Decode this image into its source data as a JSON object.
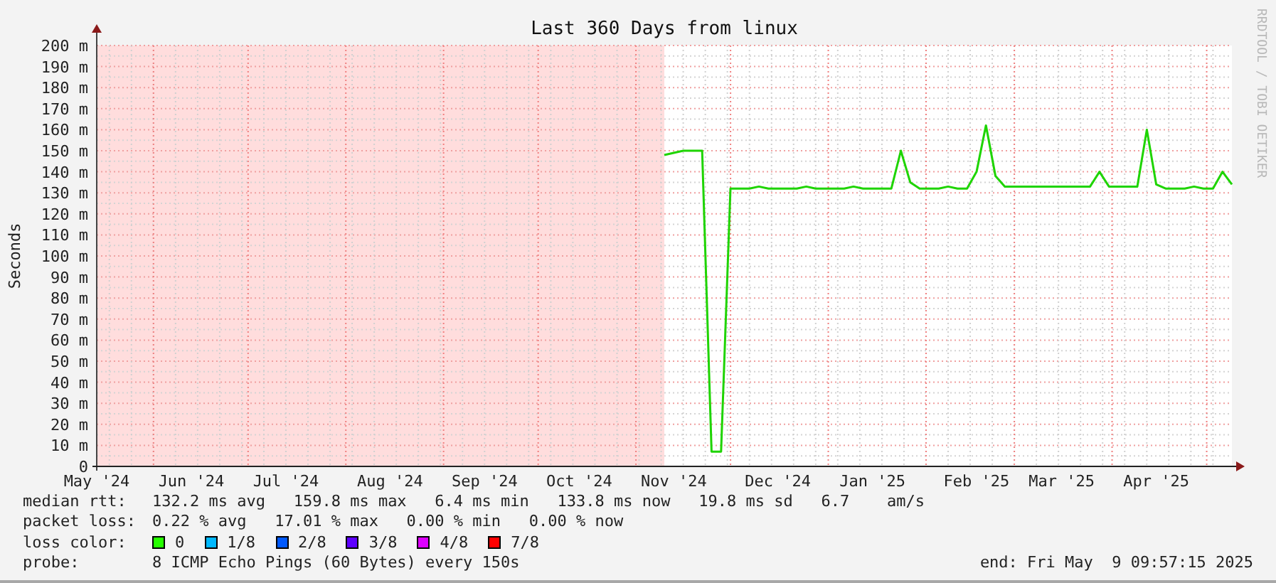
{
  "graph": {
    "title": "Last 360 Days from linux",
    "credit": "RRDTOOL / TOBI OETIKER",
    "chart_data": {
      "type": "line",
      "grid": true,
      "ylabel": "Seconds",
      "ylim": [
        0,
        200
      ],
      "categories": [
        "May '24",
        null,
        null,
        null,
        null,
        null,
        null,
        null,
        null,
        null,
        "Jun '24",
        null,
        null,
        null,
        null,
        null,
        null,
        null,
        null,
        null,
        "Jul '24",
        null,
        null,
        null,
        null,
        null,
        null,
        null,
        null,
        null,
        null,
        "Aug '24",
        null,
        null,
        null,
        null,
        null,
        null,
        null,
        null,
        null,
        "Sep '24",
        null,
        null,
        null,
        null,
        null,
        null,
        null,
        null,
        null,
        "Oct '24",
        null,
        null,
        null,
        null,
        null,
        null,
        null,
        null,
        null,
        "Nov '24",
        null,
        null,
        null,
        null,
        null,
        null,
        null,
        null,
        null,
        null,
        "Dec '24",
        null,
        null,
        null,
        null,
        null,
        null,
        null,
        null,
        null,
        "Jan '25",
        null,
        null,
        null,
        null,
        null,
        null,
        null,
        null,
        null,
        null,
        "Feb '25",
        null,
        null,
        null,
        null,
        null,
        null,
        null,
        null,
        "Mar '25",
        null,
        null,
        null,
        null,
        null,
        null,
        null,
        null,
        null,
        "Apr '25",
        null,
        null,
        null,
        null,
        null,
        null,
        null,
        null
      ],
      "series": [
        {
          "color": "#1ed400",
          "values": [
            null,
            null,
            null,
            null,
            null,
            null,
            null,
            null,
            null,
            null,
            null,
            null,
            null,
            null,
            null,
            null,
            null,
            null,
            null,
            null,
            null,
            null,
            null,
            null,
            null,
            null,
            null,
            null,
            null,
            null,
            null,
            null,
            null,
            null,
            null,
            null,
            null,
            null,
            null,
            null,
            null,
            null,
            null,
            null,
            null,
            null,
            null,
            null,
            null,
            null,
            null,
            null,
            null,
            null,
            null,
            null,
            null,
            null,
            null,
            null,
            148,
            149,
            150,
            150,
            150,
            7,
            7,
            132,
            132,
            132,
            133,
            132,
            132,
            132,
            132,
            133,
            132,
            132,
            132,
            132,
            133,
            132,
            132,
            132,
            132,
            150,
            135,
            132,
            132,
            132,
            133,
            132,
            132,
            140,
            162,
            138,
            133,
            133,
            133,
            133,
            133,
            133,
            133,
            133,
            133,
            133,
            140,
            133,
            133,
            133,
            133,
            160,
            134,
            132,
            132,
            132,
            133,
            132,
            132,
            140,
            134
          ]
        }
      ],
      "yticks": [
        {
          "value": 0,
          "label": "0"
        },
        {
          "value": 10,
          "label": "10 m"
        },
        {
          "value": 20,
          "label": "20 m"
        },
        {
          "value": 30,
          "label": "30 m"
        },
        {
          "value": 40,
          "label": "40 m"
        },
        {
          "value": 50,
          "label": "50 m"
        },
        {
          "value": 60,
          "label": "60 m"
        },
        {
          "value": 70,
          "label": "70 m"
        },
        {
          "value": 80,
          "label": "80 m"
        },
        {
          "value": 90,
          "label": "90 m"
        },
        {
          "value": 100,
          "label": "100 m"
        },
        {
          "value": 110,
          "label": "110 m"
        },
        {
          "value": 120,
          "label": "120 m"
        },
        {
          "value": 130,
          "label": "130 m"
        },
        {
          "value": 140,
          "label": "140 m"
        },
        {
          "value": 150,
          "label": "150 m"
        },
        {
          "value": 160,
          "label": "160 m"
        },
        {
          "value": 170,
          "label": "170 m"
        },
        {
          "value": 180,
          "label": "180 m"
        },
        {
          "value": 190,
          "label": "190 m"
        },
        {
          "value": 200,
          "label": "200 m"
        }
      ]
    }
  },
  "legend": {
    "median_rtt": {
      "label": "median rtt:",
      "text": "132.2 ms avg   159.8 ms max   6.4 ms min   133.8 ms now   19.8 ms sd   6.7    am/s"
    },
    "packet_loss": {
      "label": "packet loss:",
      "text": "0.22 % avg   17.01 % max   0.00 % min   0.00 % now"
    },
    "loss_color": {
      "label": "loss color:",
      "items": [
        {
          "label": "0",
          "color": "#26ff00"
        },
        {
          "label": "1/8",
          "color": "#00b8ff"
        },
        {
          "label": "2/8",
          "color": "#0059ff"
        },
        {
          "label": "3/8",
          "color": "#5e00ff"
        },
        {
          "label": "4/8",
          "color": "#dd00ff"
        },
        {
          "label": "7/8",
          "color": "#ff0000"
        }
      ]
    },
    "probe": {
      "label": "probe:",
      "text": "8 ICMP Echo Pings (60 Bytes) every 150s"
    },
    "end": "end: Fri May  9 09:57:15 2025"
  }
}
